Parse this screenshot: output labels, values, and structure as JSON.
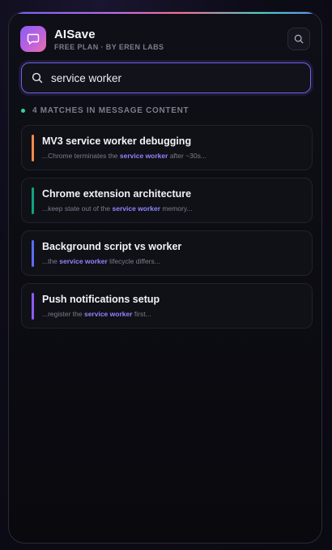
{
  "app": {
    "title": "AISave",
    "subtitle": "FREE PLAN · BY EREN LABS",
    "logo_icon": "chat-bubble-icon",
    "header_button_icon": "search-icon"
  },
  "search": {
    "value": "service worker",
    "placeholder": "",
    "icon": "search-icon"
  },
  "results": {
    "summary": "4 MATCHES IN MESSAGE CONTENT",
    "status_color": "#34d399",
    "items": [
      {
        "title": "MV3 service worker debugging",
        "snippet_before": "...Chrome terminates the ",
        "snippet_match": "service worker",
        "snippet_after": " after ~30s...",
        "accent_color": "#f08a4b"
      },
      {
        "title": "Chrome extension architecture",
        "snippet_before": "...keep state out of the ",
        "snippet_match": "service worker",
        "snippet_after": " memory...",
        "accent_color": "#10a37f"
      },
      {
        "title": "Background script vs worker",
        "snippet_before": "...the ",
        "snippet_match": "service worker",
        "snippet_after": " lifecycle differs...",
        "accent_color": "#5b6cf0"
      },
      {
        "title": "Push notifications setup",
        "snippet_before": "...register the ",
        "snippet_match": "service worker",
        "snippet_after": " first...",
        "accent_color": "#8b5cf6"
      }
    ]
  },
  "colors": {
    "accent": "#6e62e6",
    "highlight": "#8f86ff"
  }
}
